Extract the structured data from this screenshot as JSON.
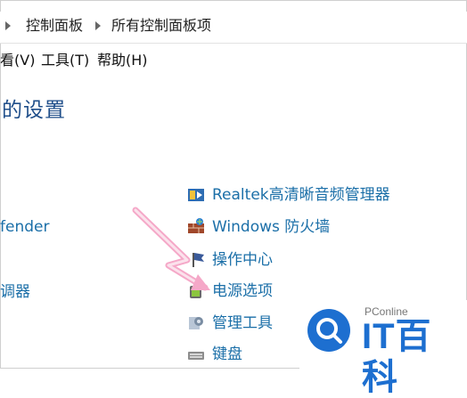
{
  "breadcrumb": {
    "items": [
      "控制面板",
      "所有控制面板项"
    ]
  },
  "menubar": {
    "items": [
      "看(V)",
      "工具(T)",
      "帮助(H)"
    ]
  },
  "page": {
    "heading": "的设置"
  },
  "left_items": [
    "fender",
    "调器"
  ],
  "right_items": [
    {
      "label": "Realtek高清晰音频管理器",
      "icon": "audio-manager-icon"
    },
    {
      "label": "Windows 防火墙",
      "icon": "firewall-icon"
    },
    {
      "label": "操作中心",
      "icon": "action-center-flag-icon"
    },
    {
      "label": "电源选项",
      "icon": "power-options-icon"
    },
    {
      "label": "管理工具",
      "icon": "admin-tools-icon"
    },
    {
      "label": "键盘",
      "icon": "keyboard-icon"
    }
  ],
  "annotation": {
    "color": "#f5a8c8"
  },
  "watermark": {
    "brand_small": "PConline",
    "brand_big": "IT百科",
    "accent": "#1d6fd0"
  },
  "colors": {
    "link": "#1b6fa8",
    "heading": "#1f4e8a"
  }
}
